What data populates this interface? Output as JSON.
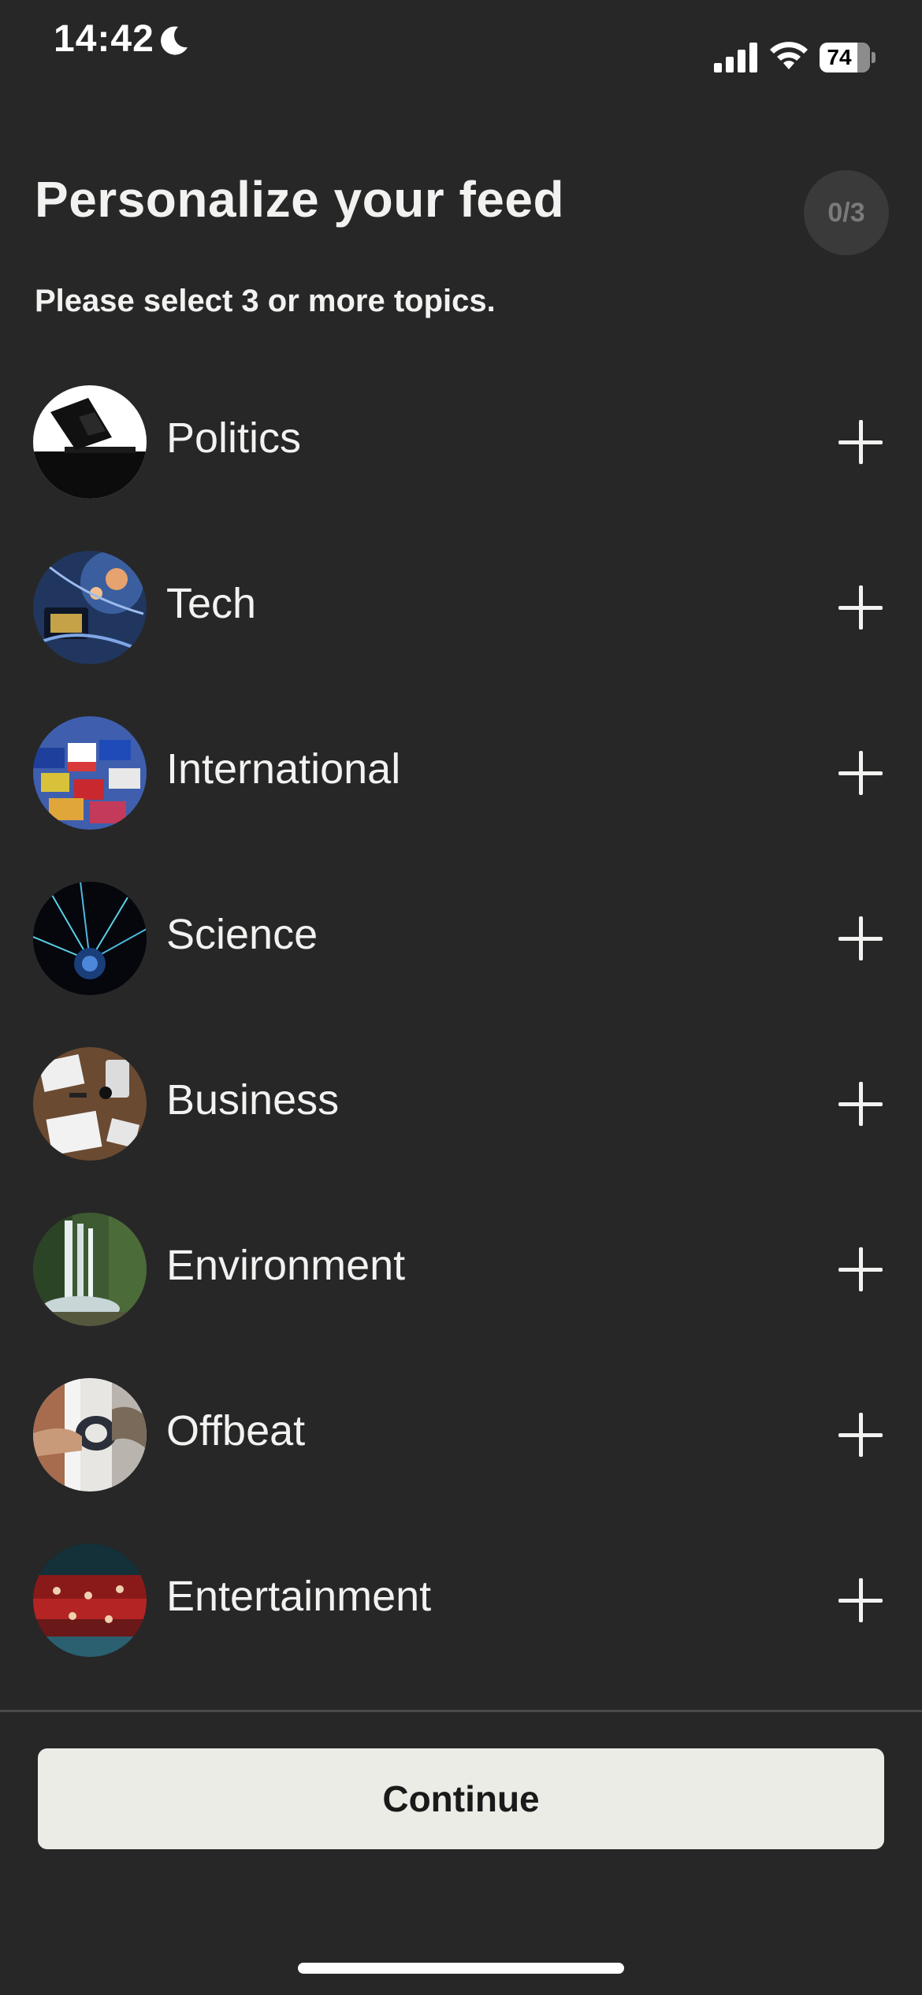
{
  "status_bar": {
    "time": "14:42",
    "battery_level": "74",
    "icons": [
      "moon-icon",
      "cellular-signal-icon",
      "wifi-icon",
      "battery-icon"
    ]
  },
  "header": {
    "title": "Personalize your feed",
    "progress": "0/3",
    "subtitle": "Please select 3 or more topics."
  },
  "topics": [
    {
      "label": "Politics",
      "icon": "politics-thumbnail",
      "action_icon": "plus-icon"
    },
    {
      "label": "Tech",
      "icon": "tech-thumbnail",
      "action_icon": "plus-icon"
    },
    {
      "label": "International",
      "icon": "international-thumbnail",
      "action_icon": "plus-icon"
    },
    {
      "label": "Science",
      "icon": "science-thumbnail",
      "action_icon": "plus-icon"
    },
    {
      "label": "Business",
      "icon": "business-thumbnail",
      "action_icon": "plus-icon"
    },
    {
      "label": "Environment",
      "icon": "environment-thumbnail",
      "action_icon": "plus-icon"
    },
    {
      "label": "Offbeat",
      "icon": "offbeat-thumbnail",
      "action_icon": "plus-icon"
    },
    {
      "label": "Entertainment",
      "icon": "entertainment-thumbnail",
      "action_icon": "plus-icon"
    }
  ],
  "footer": {
    "continue_label": "Continue"
  },
  "colors": {
    "background": "#272727",
    "text": "#f2f2f0",
    "badge_background": "#3a3a3a",
    "badge_text": "#7a7a7a",
    "button_background": "#ecece6",
    "button_text": "#1a1a1a"
  }
}
